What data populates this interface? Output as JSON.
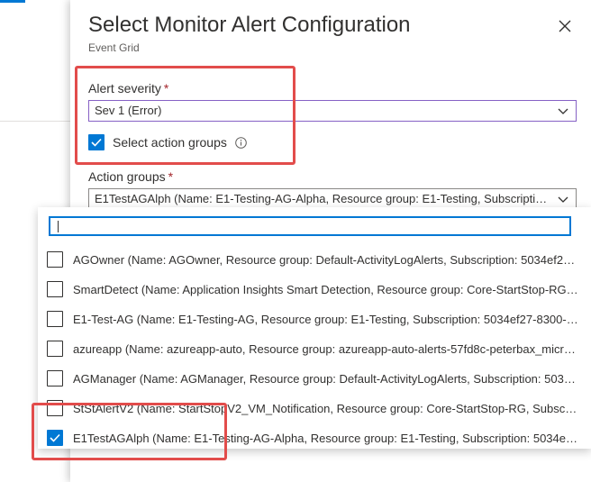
{
  "panel": {
    "title": "Select Monitor Alert Configuration",
    "subtitle": "Event Grid",
    "close_icon": "close-icon"
  },
  "alert_severity": {
    "label": "Alert severity",
    "required_mark": "*",
    "value": "Sev 1 (Error)"
  },
  "select_action_groups": {
    "label": "Select action groups",
    "checked": true,
    "info_icon": "info-icon"
  },
  "action_groups": {
    "label": "Action groups",
    "required_mark": "*",
    "value": "E1TestAGAlph (Name: E1-Testing-AG-Alpha, Resource group: E1-Testing, Subscription: ...",
    "filter_value": "",
    "options": [
      {
        "text": "AGOwner (Name: AGOwner, Resource group: Default-ActivityLogAlerts, Subscription: 5034ef27-8...",
        "checked": false
      },
      {
        "text": "SmartDetect (Name: Application Insights Smart Detection, Resource group: Core-StartStop-RG, S...",
        "checked": false
      },
      {
        "text": "E1-Test-AG (Name: E1-Testing-AG, Resource group: E1-Testing, Subscription: 5034ef27-8300-4ac...",
        "checked": false
      },
      {
        "text": "azureapp (Name: azureapp-auto, Resource group: azureapp-auto-alerts-57fd8c-peterbax_micros...",
        "checked": false
      },
      {
        "text": "AGManager (Name: AGManager, Resource group: Default-ActivityLogAlerts, Subscription: 5034ef...",
        "checked": false
      },
      {
        "text": "StStAlertV2 (Name: StartStopV2_VM_Notification, Resource group: Core-StartStop-RG, Subscripti...",
        "checked": false
      },
      {
        "text": "E1TestAGAlph (Name: E1-Testing-AG-Alpha, Resource group: E1-Testing, Subscription: 5034ef27-...",
        "checked": true
      }
    ]
  },
  "colors": {
    "accent": "#0078d4",
    "highlight_box": "#e24c4b",
    "required": "#a4262c",
    "focus_border": "#8661c5"
  }
}
